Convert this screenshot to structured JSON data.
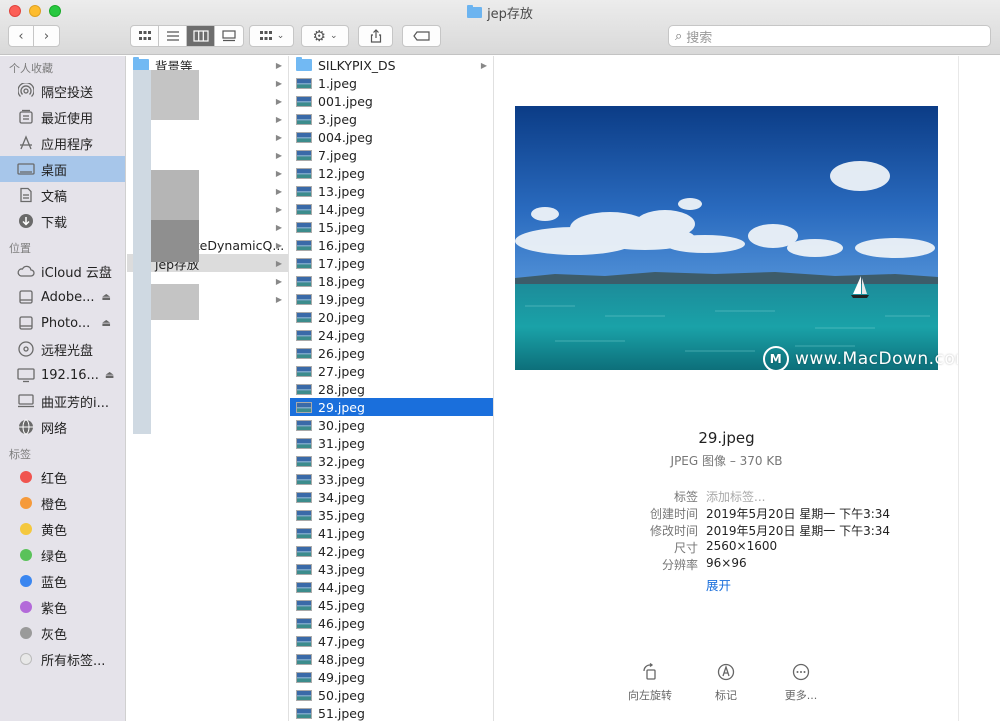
{
  "window": {
    "title": "jep存放"
  },
  "toolbar": {
    "search_placeholder": "搜索"
  },
  "sidebar": {
    "favorites_header": "个人收藏",
    "favorites": [
      {
        "label": "隔空投送",
        "icon": "airdrop-icon"
      },
      {
        "label": "最近使用",
        "icon": "recents-icon"
      },
      {
        "label": "应用程序",
        "icon": "applications-icon"
      },
      {
        "label": "桌面",
        "icon": "desktop-icon",
        "selected": true
      },
      {
        "label": "文稿",
        "icon": "documents-icon"
      },
      {
        "label": "下载",
        "icon": "downloads-icon"
      }
    ],
    "locations_header": "位置",
    "locations": [
      {
        "label": "iCloud 云盘",
        "icon": "icloud-icon"
      },
      {
        "label": "Adobe...",
        "icon": "disk-icon",
        "eject": true
      },
      {
        "label": "Photo...",
        "icon": "disk-icon",
        "eject": true
      },
      {
        "label": "远程光盘",
        "icon": "optical-disc-icon"
      },
      {
        "label": "192.16...",
        "icon": "display-icon",
        "eject": true
      },
      {
        "label": "曲亚芳的i...",
        "icon": "computer-icon"
      },
      {
        "label": "网络",
        "icon": "network-icon"
      }
    ],
    "tags_header": "标签",
    "tags": [
      {
        "label": "红色",
        "color": "#f0544f"
      },
      {
        "label": "橙色",
        "color": "#f59a3b"
      },
      {
        "label": "黄色",
        "color": "#f4c83e"
      },
      {
        "label": "绿色",
        "color": "#5ac25a"
      },
      {
        "label": "蓝色",
        "color": "#3a86f0"
      },
      {
        "label": "紫色",
        "color": "#b36ad9"
      },
      {
        "label": "灰色",
        "color": "#9a9a9a"
      },
      {
        "label": "所有标签...",
        "color": "#e8e8e8"
      }
    ]
  },
  "column1": {
    "items": [
      {
        "label": "背景等",
        "folder": true
      },
      {
        "label": "",
        "folder": true
      },
      {
        "label": "",
        "folder": true
      },
      {
        "label": "",
        "folder": true
      },
      {
        "label": "",
        "folder": true
      },
      {
        "label": "",
        "folder": true
      },
      {
        "label": "",
        "folder": true
      },
      {
        "label": "",
        "folder": true
      },
      {
        "label": "",
        "folder": true
      },
      {
        "label": "",
        "folder": true
      },
      {
        "label": "AnimateDynamicQ...",
        "folder": true
      },
      {
        "label": "jep存放",
        "folder": true,
        "selected": true
      },
      {
        "label": "",
        "folder": true
      },
      {
        "label": "",
        "folder": true
      }
    ]
  },
  "column2": {
    "items": [
      {
        "label": "SILKYPIX_DS",
        "folder": true
      },
      {
        "label": "1.jpeg"
      },
      {
        "label": "001.jpeg"
      },
      {
        "label": "3.jpeg"
      },
      {
        "label": "004.jpeg"
      },
      {
        "label": "7.jpeg"
      },
      {
        "label": "12.jpeg"
      },
      {
        "label": "13.jpeg"
      },
      {
        "label": "14.jpeg"
      },
      {
        "label": "15.jpeg"
      },
      {
        "label": "16.jpeg"
      },
      {
        "label": "17.jpeg"
      },
      {
        "label": "18.jpeg"
      },
      {
        "label": "19.jpeg"
      },
      {
        "label": "20.jpeg"
      },
      {
        "label": "24.jpeg"
      },
      {
        "label": "26.jpeg"
      },
      {
        "label": "27.jpeg"
      },
      {
        "label": "28.jpeg"
      },
      {
        "label": "29.jpeg",
        "selected": true
      },
      {
        "label": "30.jpeg"
      },
      {
        "label": "31.jpeg"
      },
      {
        "label": "32.jpeg"
      },
      {
        "label": "33.jpeg"
      },
      {
        "label": "34.jpeg"
      },
      {
        "label": "35.jpeg"
      },
      {
        "label": "41.jpeg"
      },
      {
        "label": "42.jpeg"
      },
      {
        "label": "43.jpeg"
      },
      {
        "label": "44.jpeg"
      },
      {
        "label": "45.jpeg"
      },
      {
        "label": "46.jpeg"
      },
      {
        "label": "47.jpeg"
      },
      {
        "label": "48.jpeg"
      },
      {
        "label": "49.jpeg"
      },
      {
        "label": "50.jpeg"
      },
      {
        "label": "51.jpeg"
      }
    ]
  },
  "preview": {
    "watermark": "www.MacDown.com",
    "file_name": "29.jpeg",
    "file_kind": "JPEG 图像 – 370 KB",
    "meta": [
      {
        "key": "标签",
        "value": "添加标签...",
        "placeholder": true
      },
      {
        "key": "创建时间",
        "value": "2019年5月20日 星期一 下午3:34"
      },
      {
        "key": "修改时间",
        "value": "2019年5月20日 星期一 下午3:34"
      },
      {
        "key": "尺寸",
        "value": "2560×1600"
      },
      {
        "key": "分辨率",
        "value": "96×96"
      }
    ],
    "expand_label": "展开",
    "actions": [
      {
        "label": "向左旋转",
        "icon": "rotate-left-icon"
      },
      {
        "label": "标记",
        "icon": "markup-icon"
      },
      {
        "label": "更多...",
        "icon": "more-icon"
      }
    ]
  }
}
